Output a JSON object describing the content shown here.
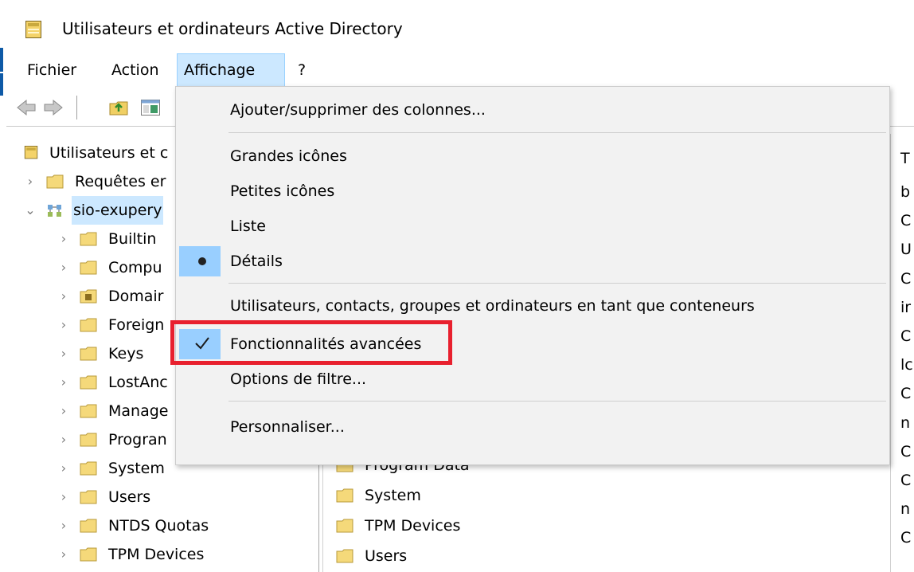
{
  "window": {
    "title": "Utilisateurs et ordinateurs Active Directory"
  },
  "menubar": {
    "items": [
      "Fichier",
      "Action",
      "Affichage",
      "?"
    ],
    "active": "Affichage"
  },
  "tree": {
    "root": "Utilisateurs et c",
    "saved_queries": "Requêtes er",
    "domain": "sio-exupery",
    "children": [
      "Builtin",
      "Compu",
      "Domair",
      "Foreign",
      "Keys",
      "LostAnc",
      "Manage",
      "Progran",
      "System",
      "Users",
      "NTDS Quotas",
      "TPM Devices"
    ]
  },
  "list": {
    "items": [
      "Program Data",
      "System",
      "TPM Devices",
      "Users"
    ]
  },
  "rightcol": {
    "header": "T",
    "rows": [
      "b",
      "C",
      "U",
      "C",
      "ir",
      "C",
      "lc",
      "C",
      "n",
      "C",
      "C",
      "n",
      "C"
    ]
  },
  "view_menu": {
    "add_remove_columns": "Ajouter/supprimer des colonnes...",
    "large_icons": "Grandes icônes",
    "small_icons": "Petites icônes",
    "list": "Liste",
    "details": "Détails",
    "users_contacts_as_containers": "Utilisateurs, contacts, groupes et ordinateurs en tant que conteneurs",
    "advanced_features": "Fonctionnalités avancées",
    "filter_options": "Options de filtre...",
    "customize": "Personnaliser...",
    "selected_view": "Détails",
    "advanced_features_checked": true
  },
  "colors": {
    "highlight": "#cce8ff",
    "menu_check_bg": "#99cfff",
    "annotation_box": "#e8202e",
    "folder": "#f5d97a"
  }
}
